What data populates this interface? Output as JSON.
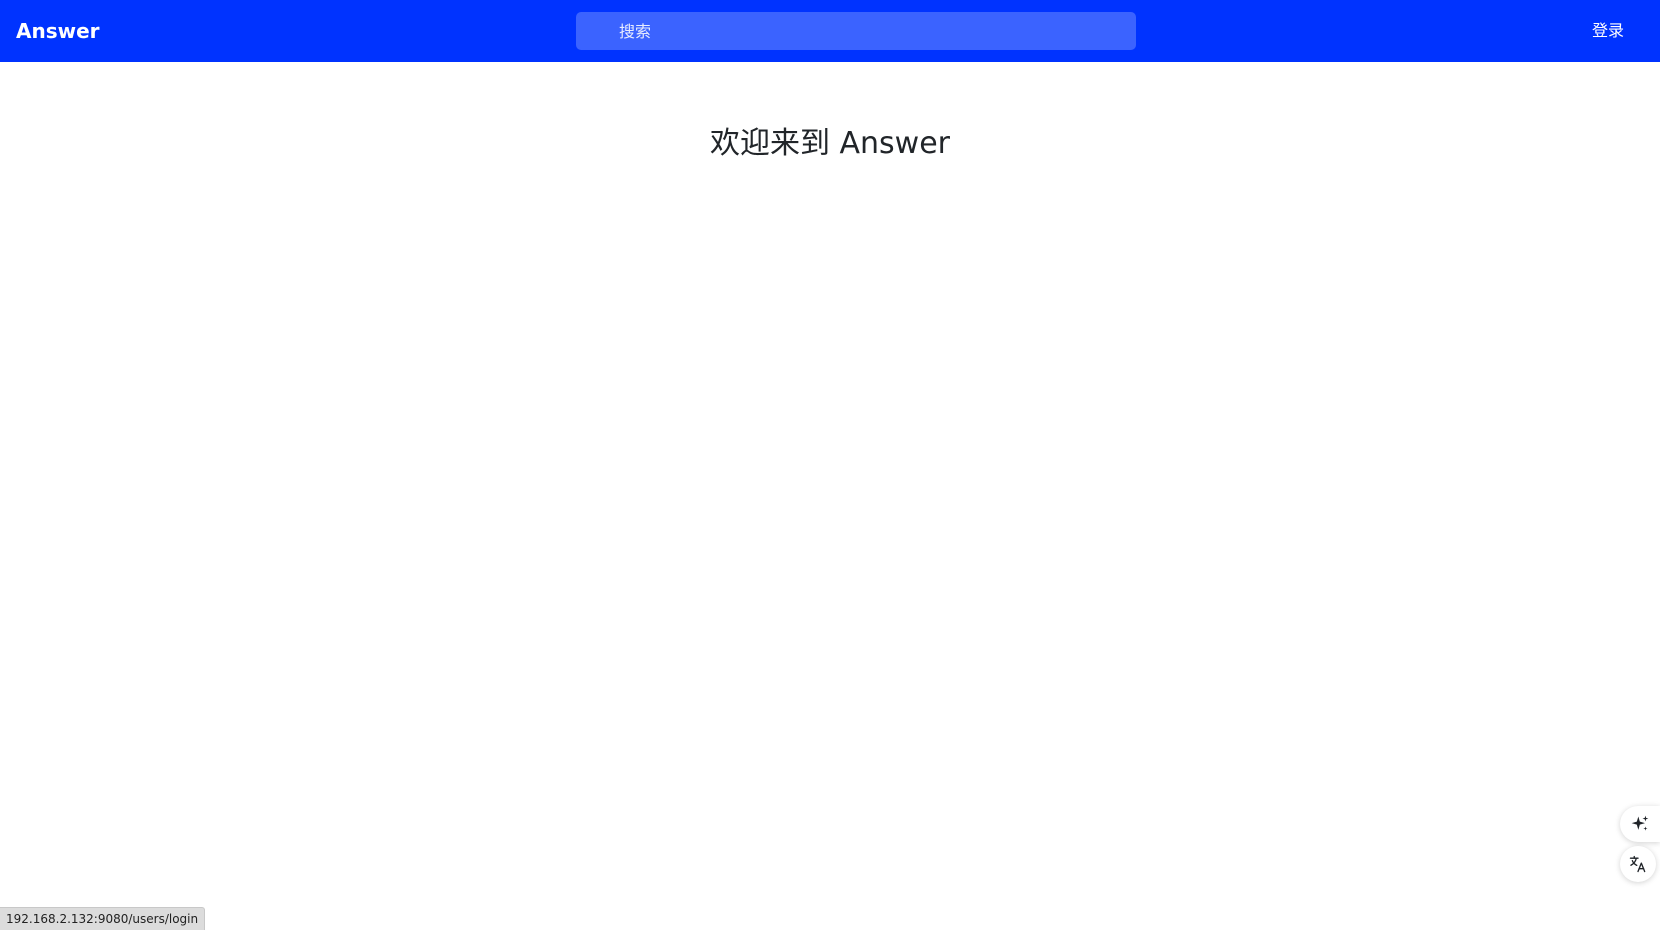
{
  "header": {
    "brand": "Answer",
    "search_placeholder": "搜索",
    "login_label": "登录",
    "background_color": "#0033ff"
  },
  "main": {
    "welcome_title": "欢迎来到 Answer"
  },
  "floating_actions": {
    "ai_icon": "sparkle-icon",
    "translate_icon": "translate-icon"
  },
  "status_bar": {
    "url": "192.168.2.132:9080/users/login"
  }
}
